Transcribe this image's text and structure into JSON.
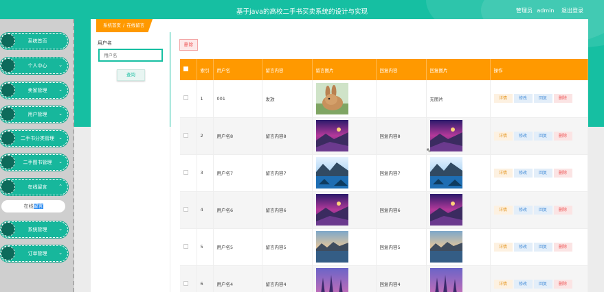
{
  "header": {
    "title": "基于java的高校二手书买卖系统的设计与实现",
    "role": "管理员",
    "username": "admin",
    "logout": "退出登录"
  },
  "sidebar": {
    "items": [
      {
        "label": "系统首页",
        "chevron": ""
      },
      {
        "label": "个人中心",
        "chevron": "⌄"
      },
      {
        "label": "卖家管理",
        "chevron": "⌄"
      },
      {
        "label": "用户管理",
        "chevron": "⌄"
      },
      {
        "label": "二手书分类管理",
        "chevron": "⌄"
      },
      {
        "label": "二手图书管理",
        "chevron": "⌄"
      },
      {
        "label": "在线留言",
        "chevron": "⌃"
      },
      {
        "label": "系统管理",
        "chevron": "⌄"
      },
      {
        "label": "订单管理",
        "chevron": "⌄"
      }
    ],
    "sub_item": {
      "prefix": "在线",
      "highlight": "留言"
    }
  },
  "breadcrumb": {
    "home": "系统首页",
    "separator": "/",
    "current": "在线留言"
  },
  "search": {
    "label": "用户名",
    "placeholder": "用户名",
    "button": "查询"
  },
  "toolbar": {
    "delete_label": "删除"
  },
  "table": {
    "headers": {
      "index": "索引",
      "username": "用户名",
      "content": "留言内容",
      "image": "留言图片",
      "reply": "回复内容",
      "reply_image": "回复图片",
      "actions": "操作"
    },
    "actions": {
      "detail": "详情",
      "edit": "修改",
      "reply": "回复",
      "delete": "删除"
    },
    "rows": [
      {
        "index": "1",
        "username": "001",
        "content": "发放",
        "image": "rabbit",
        "reply": "",
        "reply_image": "",
        "reply_image_text": "无图片"
      },
      {
        "index": "2",
        "username": "用户名8",
        "content": "留言内容8",
        "image": "purple-sunset",
        "reply": "回复内容8",
        "reply_image": "purple-sunset",
        "reply_image_text": ""
      },
      {
        "index": "3",
        "username": "用户名7",
        "content": "留言内容7",
        "image": "blue-lake",
        "reply": "回复内容7",
        "reply_image": "blue-lake",
        "reply_image_text": ""
      },
      {
        "index": "4",
        "username": "用户名6",
        "content": "留言内容6",
        "image": "purple-sunset",
        "reply": "回复内容6",
        "reply_image": "purple-sunset",
        "reply_image_text": ""
      },
      {
        "index": "5",
        "username": "用户名5",
        "content": "留言内容5",
        "image": "lake-dusk",
        "reply": "回复内容5",
        "reply_image": "lake-dusk",
        "reply_image_text": ""
      },
      {
        "index": "6",
        "username": "用户名4",
        "content": "留言内容4",
        "image": "violet-forest",
        "reply": "回复内容4",
        "reply_image": "violet-forest",
        "reply_image_text": ""
      }
    ]
  },
  "colors": {
    "primary": "#16bfa2",
    "accent": "#ff9900",
    "danger": "#ee5555"
  }
}
